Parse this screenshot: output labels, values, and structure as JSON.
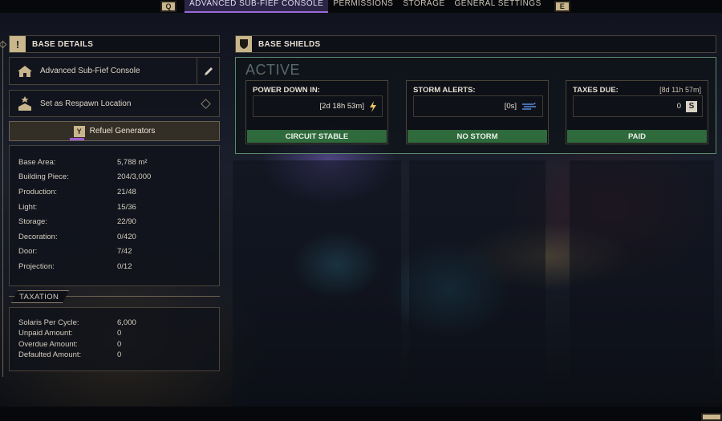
{
  "tabs": {
    "left_key": "Q",
    "items": [
      "ADVANCED SUB-FIEF CONSOLE",
      "PERMISSIONS",
      "STORAGE",
      "GENERAL SETTINGS"
    ],
    "right_key": "E"
  },
  "base_details": {
    "title": "BASE DETAILS",
    "console_label": "Advanced Sub-Fief Console",
    "respawn_label": "Set as Respawn Location",
    "refuel_label": "Refuel Generators",
    "stats": [
      {
        "label": "Base Area:",
        "value": "5,788 m²"
      },
      {
        "label": "Building Piece:",
        "value": "204/3,000"
      },
      {
        "label": "Production:",
        "value": "21/48"
      },
      {
        "label": "Light:",
        "value": "15/36"
      },
      {
        "label": "Storage:",
        "value": "22/90"
      },
      {
        "label": "Decoration:",
        "value": "0/420"
      },
      {
        "label": "Door:",
        "value": "7/42"
      },
      {
        "label": "Projection:",
        "value": "0/12"
      }
    ]
  },
  "taxation": {
    "title": "TAXATION",
    "rows": [
      {
        "label": "Solaris Per Cycle:",
        "value": "6,000"
      },
      {
        "label": "Unpaid Amount:",
        "value": "0"
      },
      {
        "label": "Overdue Amount:",
        "value": "0"
      },
      {
        "label": "Defaulted Amount:",
        "value": "0"
      }
    ]
  },
  "base_shields": {
    "title": "BASE SHIELDS",
    "state": "ACTIVE",
    "power": {
      "title": "POWER DOWN IN:",
      "value": "[2d 18h 53m]",
      "status": "CIRCUIT STABLE"
    },
    "storm": {
      "title": "STORM ALERTS:",
      "value": "[0s]",
      "status": "NO STORM"
    },
    "taxes": {
      "title": "TAXES DUE:",
      "timer": "[8d 11h 57m]",
      "value": "0",
      "status": "PAID"
    }
  },
  "colors": {
    "accent": "#c9b68d",
    "status_green": "#2f6a3c",
    "tab_active": "#9a6ad8"
  }
}
